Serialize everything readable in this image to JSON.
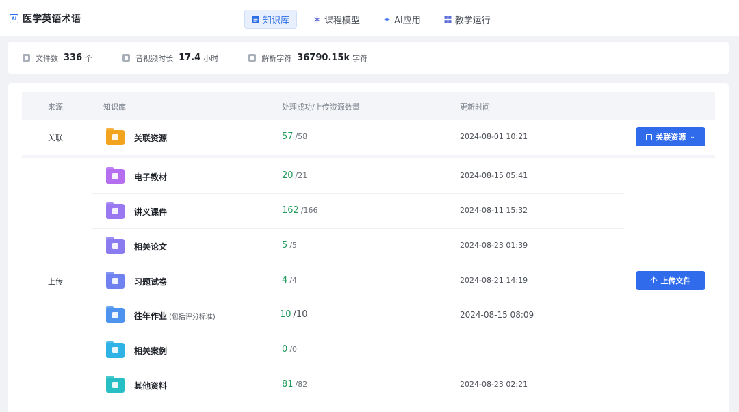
{
  "app": {
    "title": "医学英语术语",
    "logo_text": "AI"
  },
  "nav": [
    {
      "label": "知识库",
      "icon": "document-icon",
      "active": true
    },
    {
      "label": "课程模型",
      "icon": "snowflake-icon",
      "active": false
    },
    {
      "label": "AI应用",
      "icon": "sparkle-icon",
      "active": false
    },
    {
      "label": "教学运行",
      "icon": "grid-icon",
      "active": false
    }
  ],
  "stats": [
    {
      "label": "文件数",
      "value": "336",
      "unit": "个",
      "icon": "file-icon"
    },
    {
      "label": "音视频时长",
      "value": "17.4",
      "unit": "小时",
      "icon": "video-icon"
    },
    {
      "label": "解析字符",
      "value": "36790.15k",
      "unit": "字符",
      "icon": "text-icon"
    }
  ],
  "table": {
    "headers": {
      "source": "来源",
      "kb": "知识库",
      "count": "处理成功/上传资源数量",
      "time": "更新时间"
    },
    "groups": [
      {
        "source": "关联",
        "action": "关联资源",
        "rows": [
          {
            "name": "关联资源",
            "note": "",
            "ok": "57",
            "total": "/58",
            "time": "2024-08-01 10:21",
            "color": "#f3a41f"
          }
        ]
      },
      {
        "source": "上传",
        "action": "上传文件",
        "rows": [
          {
            "name": "电子教材",
            "note": "",
            "ok": "20",
            "total": "/21",
            "time": "2024-08-15 05:41",
            "color": "#b56ef0"
          },
          {
            "name": "讲义课件",
            "note": "",
            "ok": "162",
            "total": "/166",
            "time": "2024-08-11 15:32",
            "color": "#9a78f2"
          },
          {
            "name": "相关论文",
            "note": "",
            "ok": "5",
            "total": "/5",
            "time": "2024-08-23 01:39",
            "color": "#8b7bf0"
          },
          {
            "name": "习题试卷",
            "note": "",
            "ok": "4",
            "total": "/4",
            "time": "2024-08-21 14:19",
            "color": "#6f82f0"
          },
          {
            "name": "往年作业",
            "note": "(包括评分标准)",
            "ok": "10",
            "total": "/10",
            "time": "2024-08-15 08:09",
            "color": "#4e94ee"
          },
          {
            "name": "相关案例",
            "note": "",
            "ok": "0",
            "total": "/0",
            "time": "",
            "color": "#2fb3e6"
          },
          {
            "name": "其他资料",
            "note": "",
            "ok": "81",
            "total": "/82",
            "time": "2024-08-23 02:21",
            "color": "#27bfc4"
          }
        ]
      }
    ]
  }
}
